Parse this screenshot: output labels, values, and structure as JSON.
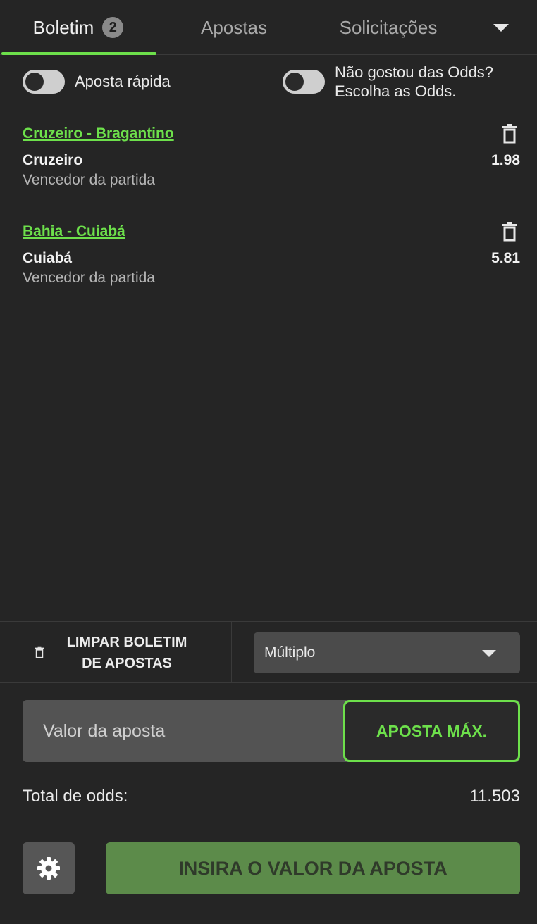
{
  "tabs": {
    "boletim": {
      "label": "Boletim",
      "badge": "2"
    },
    "apostas": {
      "label": "Apostas"
    },
    "solicitacoes": {
      "label": "Solicitações"
    }
  },
  "toggles": {
    "quick_bet": {
      "label": "Aposta rápida",
      "on": false
    },
    "choose_odds": {
      "line1": "Não gostou das Odds?",
      "line2": "Escolha as Odds.",
      "on": false
    }
  },
  "bets": [
    {
      "match": "Cruzeiro - Bragantino",
      "selection": "Cruzeiro",
      "odds": "1.98",
      "market": "Vencedor da partida"
    },
    {
      "match": "Bahia - Cuiabá",
      "selection": "Cuiabá",
      "odds": "5.81",
      "market": "Vencedor da partida"
    }
  ],
  "controls": {
    "clear_line1": "LIMPAR BOLETIM",
    "clear_line2": "DE APOSTAS",
    "bet_type": "Múltiplo"
  },
  "stake": {
    "placeholder": "Valor da aposta",
    "max_label": "APOSTA MÁX."
  },
  "total": {
    "label": "Total de odds:",
    "value": "11.503"
  },
  "submit": {
    "label": "INSIRA O VALOR DA APOSTA"
  },
  "colors": {
    "accent": "#6de04b",
    "background": "#252525",
    "submit_bg": "#5c8b4a"
  }
}
